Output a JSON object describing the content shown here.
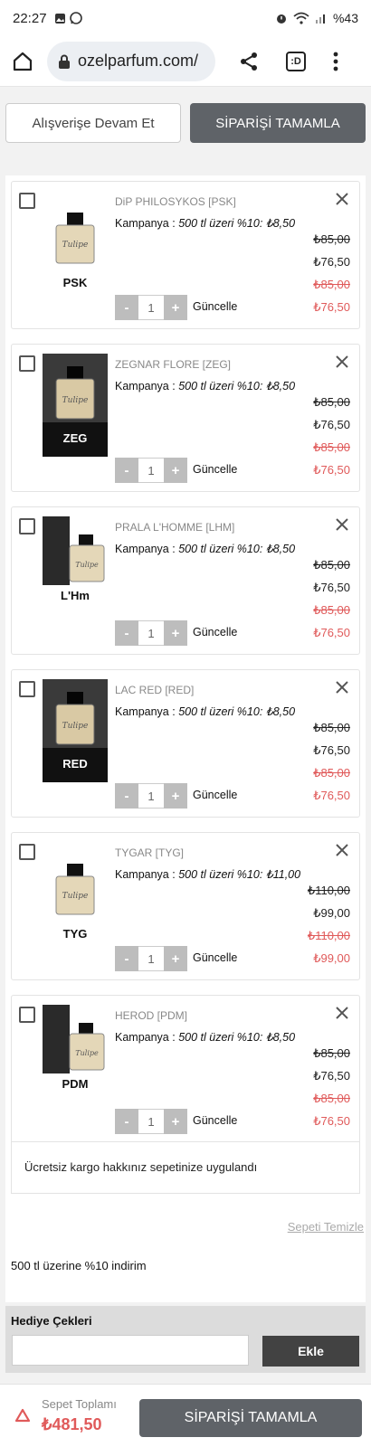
{
  "status": {
    "time": "22:27",
    "battery": "%43"
  },
  "browser": {
    "url": "ozelparfum.com/"
  },
  "top": {
    "continue_label": "Alışverişe Devam Et",
    "complete_label": "SİPARİŞİ TAMAMLA"
  },
  "colors": {
    "dark_button": "#5f6368",
    "discount_red": "#e05a5a",
    "gift_bg": "#dcdcdc"
  },
  "items": [
    {
      "name": "DiP PHILOSYKOS [PSK]",
      "campaign_label": "Kampanya : ",
      "campaign": "500 tl üzeri %10: ₺8,50",
      "code": "PSK",
      "style": "white",
      "qty": "1",
      "update": "Güncelle",
      "old_price": "₺85,00",
      "price": "₺76,50",
      "old_total": "₺85,00",
      "total": "₺76,50"
    },
    {
      "name": "ZEGNAR FLORE [ZEG]",
      "campaign_label": "Kampanya : ",
      "campaign": "500 tl üzeri %10: ₺8,50",
      "code": "ZEG",
      "style": "dark",
      "qty": "1",
      "update": "Güncelle",
      "old_price": "₺85,00",
      "price": "₺76,50",
      "old_total": "₺85,00",
      "total": "₺76,50"
    },
    {
      "name": "PRALA L'HOMME [LHM]",
      "campaign_label": "Kampanya : ",
      "campaign": "500 tl üzeri %10: ₺8,50",
      "code": "L'Hm",
      "style": "split",
      "qty": "1",
      "update": "Güncelle",
      "old_price": "₺85,00",
      "price": "₺76,50",
      "old_total": "₺85,00",
      "total": "₺76,50"
    },
    {
      "name": "LAC RED [RED]",
      "campaign_label": "Kampanya : ",
      "campaign": "500 tl üzeri %10: ₺8,50",
      "code": "RED",
      "style": "dark",
      "qty": "1",
      "update": "Güncelle",
      "old_price": "₺85,00",
      "price": "₺76,50",
      "old_total": "₺85,00",
      "total": "₺76,50"
    },
    {
      "name": "TYGAR [TYG]",
      "campaign_label": "Kampanya : ",
      "campaign": "500 tl üzeri %10: ₺11,00",
      "code": "TYG",
      "style": "white",
      "qty": "1",
      "update": "Güncelle",
      "old_price": "₺110,00",
      "price": "₺99,00",
      "old_total": "₺110,00",
      "total": "₺99,00"
    },
    {
      "name": "HEROD [PDM]",
      "campaign_label": "Kampanya : ",
      "campaign": "500 tl üzeri %10: ₺8,50",
      "code": "PDM",
      "style": "split",
      "qty": "1",
      "update": "Güncelle",
      "old_price": "₺85,00",
      "price": "₺76,50",
      "old_total": "₺85,00",
      "total": "₺76,50"
    }
  ],
  "cargo_note": "Ücretsiz kargo hakkınız sepetinize uygulandı",
  "clear_cart": "Sepeti Temizle",
  "discount_note": "500 tl üzerine %10 indirim",
  "gift": {
    "title": "Hediye Çekleri",
    "input_value": "",
    "add_label": "Ekle"
  },
  "footer": {
    "total_label": "Sepet Toplamı",
    "total_value": "₺481,50",
    "complete_label": "SİPARİŞİ TAMAMLA"
  }
}
